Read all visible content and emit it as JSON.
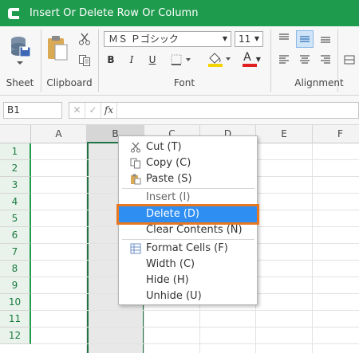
{
  "window": {
    "title": "Insert Or Delete Row Or Column"
  },
  "ribbon": {
    "groups": {
      "sheet": "Sheet",
      "clipboard": "Clipboard",
      "font": "Font",
      "alignment": "Alignment"
    },
    "font_name": "ＭＳ Ｐゴシック",
    "font_size": "11",
    "bold": "B",
    "italic": "I",
    "underline": "U",
    "font_color_letter": "A",
    "colors": {
      "accent": "#1f9b4e",
      "font_color": "#e02020",
      "fill_color": "#f2d400",
      "highlight": "#2f8ef2",
      "focus_ring": "#e87722"
    }
  },
  "formula_bar": {
    "name_box": "B1",
    "cancel": "✕",
    "enter": "✓",
    "fx": "fx",
    "formula": ""
  },
  "grid": {
    "columns": [
      "A",
      "B",
      "C",
      "D",
      "E",
      "F"
    ],
    "rows": [
      "1",
      "2",
      "3",
      "4",
      "5",
      "6",
      "7",
      "8",
      "9",
      "10",
      "11",
      "12"
    ],
    "selected_column": "B"
  },
  "context_menu": {
    "items": [
      {
        "label": "Cut (T)",
        "icon": "scissors-icon"
      },
      {
        "label": "Copy (C)",
        "icon": "copy-icon"
      },
      {
        "label": "Paste (S)",
        "icon": "paste-icon"
      },
      {
        "label": "Insert (I)",
        "icon": ""
      },
      {
        "label": "Delete (D)",
        "icon": "",
        "highlighted": true
      },
      {
        "label": "Clear Contents (N)",
        "icon": ""
      },
      {
        "label": "Format Cells (F)",
        "icon": "format-cells-icon"
      },
      {
        "label": "Width (C)",
        "icon": ""
      },
      {
        "label": "Hide (H)",
        "icon": ""
      },
      {
        "label": "Unhide (U)",
        "icon": ""
      }
    ]
  }
}
